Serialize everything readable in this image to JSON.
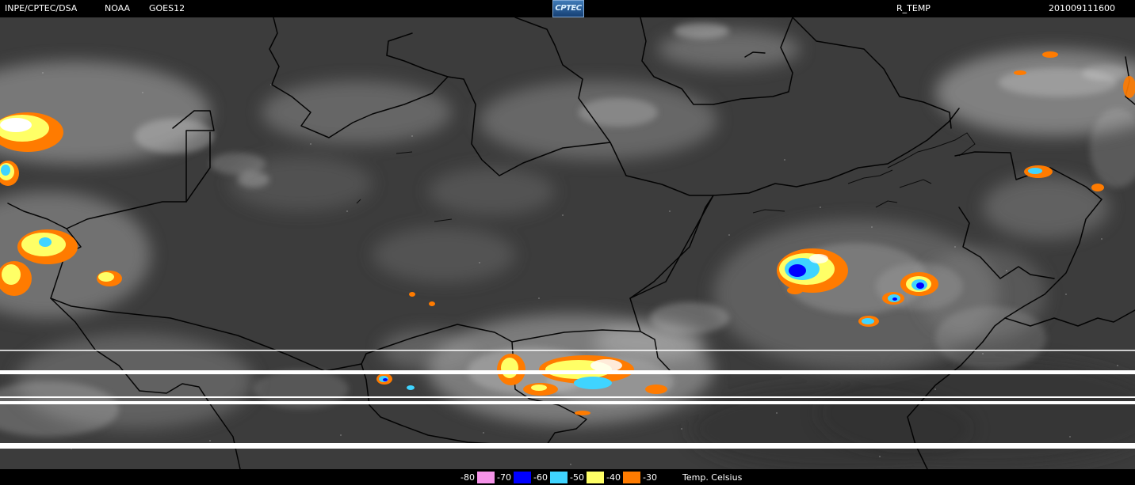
{
  "header": {
    "source": "INPE/CPTEC/DSA",
    "agency": "NOAA",
    "satellite": "GOES12",
    "logo_text": "CPTEC",
    "product": "R_TEMP",
    "timestamp": "201009111600"
  },
  "legend": {
    "items": [
      {
        "label": "-80",
        "color": "#f593e8"
      },
      {
        "label": "-70",
        "color": "#0000ff"
      },
      {
        "label": "-60",
        "color": "#3fd4ff"
      },
      {
        "label": "-50",
        "color": "#ffff66"
      },
      {
        "label": "-40",
        "color": "#ff7b00"
      },
      {
        "label": "-30",
        "color": "#ffffff"
      }
    ],
    "unit": "Temp. Celsius"
  }
}
